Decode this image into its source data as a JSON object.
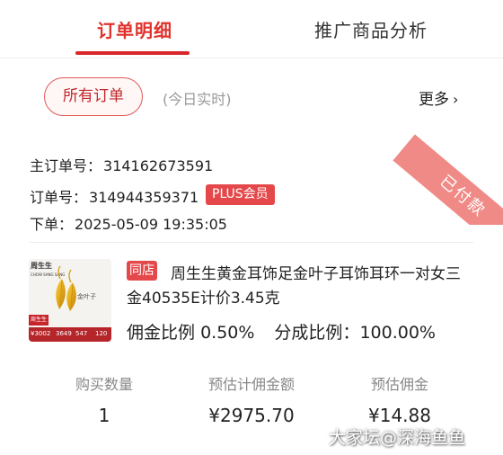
{
  "tabs": [
    {
      "label": "订单明细",
      "active": true
    },
    {
      "label": "推广商品分析",
      "active": false
    }
  ],
  "filter": {
    "selected_label": "所有订单",
    "note": "(今日实时)",
    "more_label": "更多"
  },
  "order": {
    "status_ribbon": "已付款",
    "main_order_label": "主订单号：",
    "main_order_no": "314162673591",
    "order_label": "订单号：",
    "order_no": "314944359371",
    "plus_badge": "PLUS会员",
    "placed_label": "下单：",
    "placed_time": "2025-05-09 19:35:05"
  },
  "product": {
    "store_badge": "同店",
    "title_line1": "周生生黄金耳饰足金叶子耳饰耳环一对女三",
    "title_line2": "金40535E计价3.45克",
    "commission_rate_label": "佣金比例",
    "commission_rate": "0.50%",
    "share_rate_label": "分成比例：",
    "share_rate": "100.00%",
    "thumb": {
      "brand": "周生生",
      "brand_sub": "CHOW SANG SANG",
      "caption": "金叶子",
      "tag": "周生生",
      "bar_values": [
        "¥3002",
        "3649",
        "547",
        "120"
      ]
    }
  },
  "stats": [
    {
      "label": "购买数量",
      "value": "1"
    },
    {
      "label": "预估计佣金额",
      "value": "¥2975.70"
    },
    {
      "label": "预估佣金",
      "value": "¥14.88"
    }
  ],
  "watermark": "大家坛@深海鱼鱼",
  "colors": {
    "accent": "#e0322c",
    "badge": "#e5484a",
    "ribbon": "#f08a86"
  }
}
